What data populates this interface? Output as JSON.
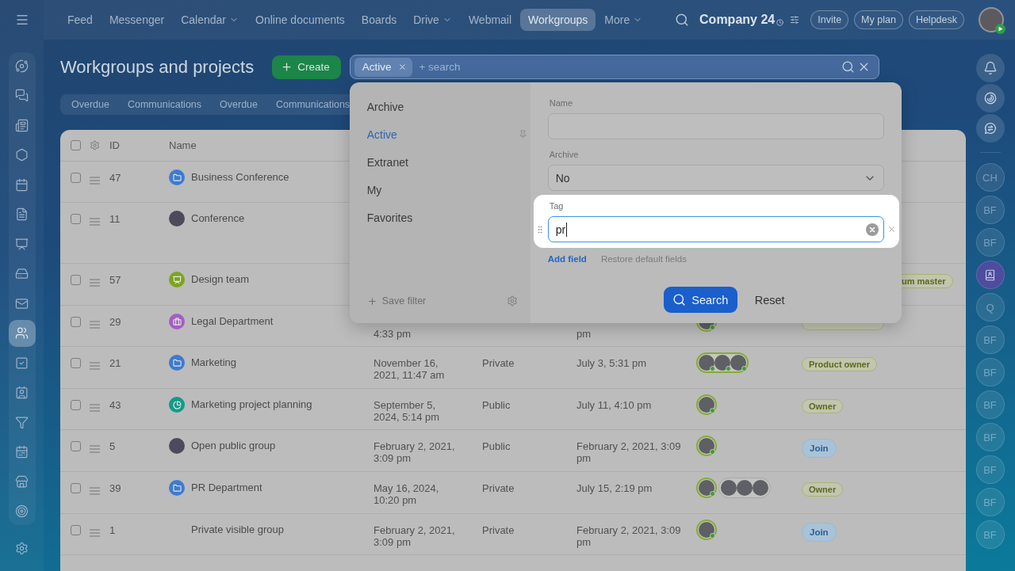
{
  "top_bar": {
    "nav": [
      {
        "label": "Feed",
        "selected": false,
        "has_menu": false
      },
      {
        "label": "Messenger",
        "selected": false,
        "has_menu": false
      },
      {
        "label": "Calendar",
        "selected": false,
        "has_menu": true
      },
      {
        "label": "Online documents",
        "selected": false,
        "has_menu": false
      },
      {
        "label": "Boards",
        "selected": false,
        "has_menu": false
      },
      {
        "label": "Drive",
        "selected": false,
        "has_menu": true
      },
      {
        "label": "Webmail",
        "selected": false,
        "has_menu": false
      },
      {
        "label": "Workgroups",
        "selected": true,
        "has_menu": false
      },
      {
        "label": "More",
        "selected": false,
        "has_menu": true
      }
    ],
    "company": "Company 24",
    "buttons": [
      "Invite",
      "My plan",
      "Helpdesk"
    ]
  },
  "sidebar": {
    "items": [
      {
        "selected": false
      },
      {
        "selected": false
      },
      {
        "selected": false
      },
      {
        "selected": false
      },
      {
        "selected": false
      },
      {
        "selected": false
      },
      {
        "selected": false
      },
      {
        "selected": false
      },
      {
        "selected": false
      },
      {
        "selected": true
      },
      {
        "selected": false
      },
      {
        "selected": false
      },
      {
        "selected": false
      },
      {
        "selected": false
      },
      {
        "selected": false
      },
      {
        "selected": false
      }
    ]
  },
  "header": {
    "title": "Workgroups and projects",
    "create_button": "Create",
    "filter": {
      "chips": [
        "Active"
      ],
      "placeholder": "+ search"
    }
  },
  "counters": [
    "Overdue",
    "Communications",
    "Overdue",
    "Communications"
  ],
  "table": {
    "header_checked": false,
    "columns": [
      "ID",
      "Name"
    ],
    "rows": [
      {
        "checked": false,
        "id": "47",
        "name": "Business Conference",
        "logo": {
          "kind": "folder",
          "color": "#3d7bd0"
        }
      },
      {
        "checked": false,
        "id": "11",
        "name": "Conference",
        "logo": {
          "kind": "photo"
        }
      },
      {
        "checked": false,
        "id": "57",
        "name": "Design team",
        "logo": {
          "kind": "presentation",
          "color": "#7ba51e"
        },
        "role": {
          "kind": "tag",
          "label": "um master",
          "clipped": true
        }
      },
      {
        "checked": false,
        "id": "29",
        "name": "Legal Department",
        "logo": {
          "kind": "briefcase",
          "color": "#a35fc0"
        },
        "covered_top": true,
        "created": "4:33 pm",
        "activity": "pm",
        "members": [
          {
            "kind": "owner",
            "avatars": [
              {
                "badge": true
              }
            ]
          }
        ],
        "role": {
          "kind": "tag",
          "clipped": false
        }
      },
      {
        "checked": false,
        "id": "21",
        "name": "Marketing",
        "logo": {
          "kind": "folder",
          "color": "#3d7bd0"
        },
        "covered_top": false,
        "created": "November 16, 2021, 11:47 am",
        "type": "Private",
        "activity": "July 3, 5:31 pm",
        "members": [
          {
            "kind": "owner",
            "avatars": [
              {
                "badge": true
              },
              {
                "badge": true
              },
              {
                "badge": true
              }
            ]
          }
        ],
        "role": {
          "kind": "tag",
          "label": "Product owner",
          "clipped": false
        }
      },
      {
        "checked": false,
        "id": "43",
        "name": "Marketing project planning",
        "logo": {
          "kind": "pie",
          "color": "#149b8a"
        },
        "covered_top": false,
        "created": "September 5, 2024, 5:14 pm",
        "type": "Public",
        "activity": "July 11, 4:10 pm",
        "members": [
          {
            "kind": "owner",
            "avatars": [
              {
                "badge": true
              }
            ]
          }
        ],
        "role": {
          "kind": "tag",
          "label": "Owner",
          "clipped": false
        }
      },
      {
        "checked": false,
        "id": "5",
        "name": "Open public group",
        "logo": {
          "kind": "photo"
        },
        "covered_top": false,
        "created": "February 2, 2021, 3:09 pm",
        "type": "Public",
        "activity": "February 2, 2021, 3:09 pm",
        "members": [
          {
            "kind": "owner",
            "avatars": [
              {
                "badge": true
              }
            ]
          }
        ],
        "role": {
          "kind": "join",
          "label": "Join"
        }
      },
      {
        "checked": false,
        "id": "39",
        "name": "PR Department",
        "logo": {
          "kind": "folder",
          "color": "#3d7bd0"
        },
        "covered_top": false,
        "created": "May 16, 2024, 10:20 pm",
        "type": "Private",
        "activity": "July 15, 2:19 pm",
        "members": [
          {
            "kind": "owner",
            "avatars": [
              {
                "badge": true
              }
            ]
          },
          {
            "kind": "member",
            "avatars": [
              {
                "badge": false
              },
              {
                "badge": false
              },
              {
                "badge": false
              }
            ]
          }
        ],
        "role": {
          "kind": "tag",
          "label": "Owner",
          "clipped": false
        }
      },
      {
        "checked": false,
        "id": "1",
        "name": "Private visible group",
        "covered_top": false,
        "created": "February 2, 2021, 3:09 pm",
        "type": "Private",
        "activity": "February 2, 2021, 3:09 pm",
        "members": [
          {
            "kind": "owner",
            "avatars": [
              {
                "badge": true
              }
            ]
          }
        ],
        "role": {
          "kind": "join",
          "label": "Join"
        }
      }
    ]
  },
  "filter_popup": {
    "presets": [
      {
        "label": "Archive",
        "selected": false,
        "pinned": false
      },
      {
        "label": "Active",
        "selected": true,
        "pinned": true
      },
      {
        "label": "Extranet",
        "selected": false,
        "pinned": false
      },
      {
        "label": "My",
        "selected": false,
        "pinned": false
      },
      {
        "label": "Favorites",
        "selected": false,
        "pinned": false
      }
    ],
    "save_filter": "Save filter",
    "fields": [
      {
        "kind": "text",
        "label": "Name",
        "highlighted": false,
        "focused": false
      },
      {
        "kind": "select",
        "label": "Archive",
        "value": "No",
        "highlighted": false
      },
      {
        "kind": "text",
        "label": "Tag",
        "value": "pr",
        "highlighted": true,
        "focused": true
      }
    ],
    "add_field": "Add field",
    "restore_fields": "Restore default fields",
    "search_button": "Search",
    "reset_button": "Reset"
  },
  "right_rail": {
    "chats": [
      {
        "kind": "initials",
        "label": "CH"
      },
      {
        "kind": "initials",
        "label": "BF"
      },
      {
        "kind": "initials",
        "label": "BF"
      },
      {
        "kind": "contact"
      },
      {
        "kind": "initials",
        "label": "Q"
      },
      {
        "kind": "initials",
        "label": "BF"
      },
      {
        "kind": "initials",
        "label": "BF"
      },
      {
        "kind": "initials",
        "label": "BF"
      },
      {
        "kind": "initials",
        "label": "BF"
      },
      {
        "kind": "initials",
        "label": "BF"
      },
      {
        "kind": "initials",
        "label": "BF"
      },
      {
        "kind": "initials",
        "label": "BF"
      }
    ]
  }
}
